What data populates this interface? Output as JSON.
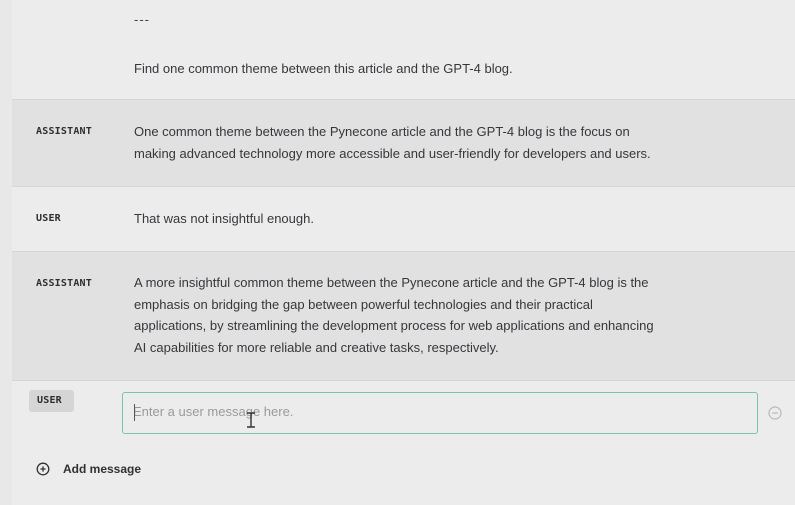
{
  "conversation": {
    "intro": {
      "divider": "---",
      "text": "Find one common theme between this article and the GPT-4 blog."
    },
    "messages": [
      {
        "role": "ASSISTANT",
        "lines": [
          "One common theme between the Pynecone article and the GPT-4 blog is the focus on",
          "making advanced technology more accessible and user-friendly for developers and users."
        ]
      },
      {
        "role": "USER",
        "lines": [
          "That was not insightful enough."
        ]
      },
      {
        "role": "ASSISTANT",
        "lines": [
          "A more insightful common theme between the Pynecone article and the GPT-4 blog is the",
          "emphasis on bridging the gap between powerful technologies and their practical",
          "applications, by streamlining the development process for web applications and enhancing",
          "AI capabilities for more reliable and creative tasks, respectively."
        ]
      }
    ],
    "composer": {
      "role": "USER",
      "placeholder": "Enter a user message here.",
      "remove_icon": "minus-circle-icon"
    },
    "add_message": {
      "label": "Add message",
      "icon": "plus-circle-icon"
    }
  },
  "colors": {
    "light_row": "#ececec",
    "dark_row": "#e1e1e1",
    "input_border": "#79c5a6",
    "placeholder": "#9a9a9a"
  }
}
